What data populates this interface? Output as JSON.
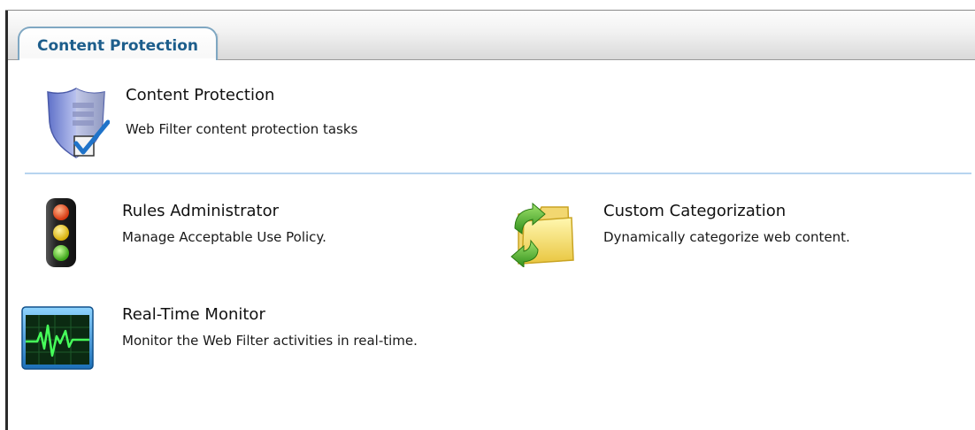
{
  "tab": {
    "label": "Content Protection"
  },
  "header": {
    "title": "Content Protection",
    "description": "Web Filter content protection tasks",
    "icon": "shield-check-icon"
  },
  "tasks": [
    {
      "title": "Rules Administrator",
      "description": "Manage Acceptable Use Policy.",
      "icon": "traffic-light-icon"
    },
    {
      "title": "Custom Categorization",
      "description": "Dynamically categorize web content.",
      "icon": "folder-refresh-icon"
    },
    {
      "title": "Real-Time Monitor",
      "description": "Monitor the Web Filter activities in real-time.",
      "icon": "activity-monitor-icon"
    }
  ],
  "colors": {
    "tab_text": "#1d5e8c",
    "tab_border": "#7fa7c2",
    "divider": "#b7d4ef"
  }
}
